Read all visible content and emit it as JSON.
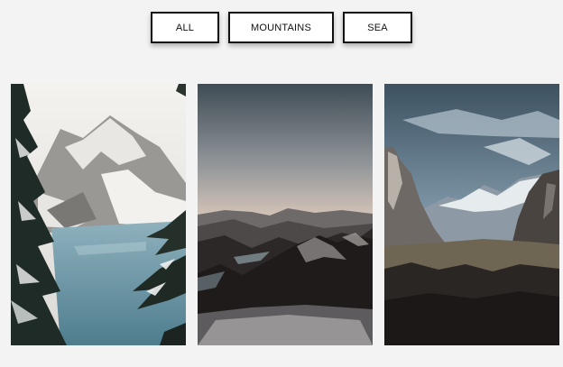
{
  "filters": {
    "items": [
      {
        "label": "ALL"
      },
      {
        "label": "MOUNTAINS"
      },
      {
        "label": "SEA"
      }
    ]
  },
  "gallery": {
    "photos": [
      {
        "subject": "snowy mountain lake with pine trees"
      },
      {
        "subject": "mountain ridges at dusk"
      },
      {
        "subject": "granite valley with cliffs"
      }
    ]
  }
}
